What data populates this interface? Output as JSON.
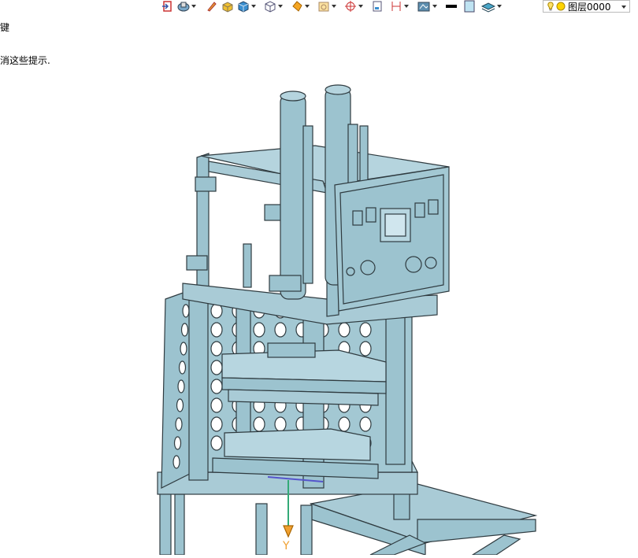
{
  "hint": {
    "line1": "键",
    "line2": "消这些提示."
  },
  "toolbar": {
    "icons": [
      "exit-icon",
      "view-orient-icon",
      "pencil-icon",
      "box-icon",
      "cube-solid-icon",
      "cube-wire-icon",
      "sphere-icon",
      "camera-icon",
      "crosshair-icon",
      "page-icon",
      "dimension-icon",
      "render-icon",
      "color-black-swatch",
      "color-light-swatch",
      "layers-icon"
    ]
  },
  "layer": {
    "label": "图层0000"
  },
  "viewport": {
    "axis_label": "Y"
  },
  "colors": {
    "model_fill": "#9cc3cf",
    "model_stroke": "#2f3b40",
    "background": "#ffffff"
  }
}
